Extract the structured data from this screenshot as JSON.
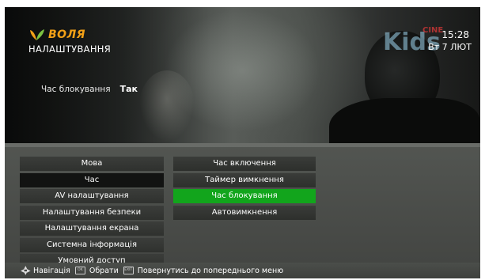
{
  "header": {
    "brand": "ВОЛЯ",
    "menu_title": "НАЛАШТУВАННЯ",
    "status_label": "Час блокування",
    "status_value": "Так",
    "time": "15:28",
    "date": "Вт 7 ЛЮТ",
    "channel_logo_text": "Kids",
    "channel_logo_sub": "CINE"
  },
  "menu": {
    "left_items": [
      {
        "label": "Мова"
      },
      {
        "label": "Час",
        "current": true
      },
      {
        "label": "AV налаштування"
      },
      {
        "label": "Налаштування безпеки"
      },
      {
        "label": "Налаштування екрана"
      },
      {
        "label": "Системна інформація"
      },
      {
        "label": "Умовний доступ"
      }
    ],
    "right_items": [
      {
        "label": "Час включення"
      },
      {
        "label": "Таймер вимкнення"
      },
      {
        "label": "Час блокування",
        "selected": true
      },
      {
        "label": "Автовимкнення"
      }
    ]
  },
  "hints": {
    "navigate": "Навігація",
    "ok_key": "OK",
    "select": "Обрати",
    "back_key": "EXIT",
    "back": "Повернутись до попереднього меню"
  },
  "colors": {
    "accent_green": "#12a51c",
    "brand_orange": "#f2a017"
  }
}
